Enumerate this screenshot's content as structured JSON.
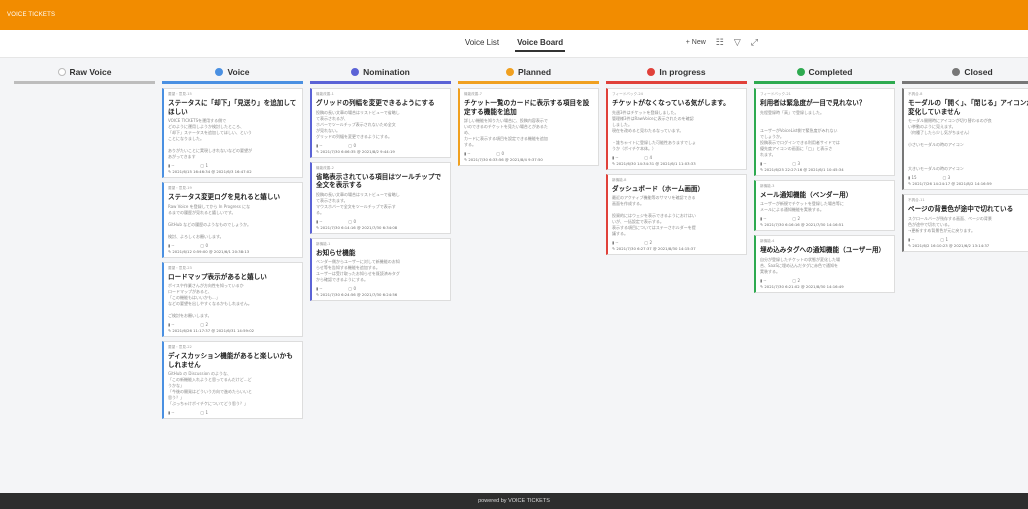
{
  "app_title": "VOICE TICKETS",
  "tabs": [
    {
      "label": "Voice List"
    },
    {
      "label": "Voice Board"
    }
  ],
  "toolbar": {
    "new_label": "+ New"
  },
  "footer": "powered by VOICE TICKETS",
  "columns": [
    {
      "title": "Raw Voice",
      "color": "#bdbdbd",
      "icon_color": "#ffffff",
      "cards": []
    },
    {
      "title": "Voice",
      "color": "#4a90e2",
      "icon_color": "#4a90e2",
      "cards": [
        {
          "id": "要望・意見-15",
          "title": "ステータスに「却下」「見送り」を追加してほしい",
          "body": "VOICE TICKETSを運用する側で\nどのように運用しようか検討したところ、\n「却下」ステータスを追加してほしい、という\nことになりました。\n\nありがたいことに実現しきれないなどの要望が\nあがってきます",
          "votes": "--",
          "comments": "1",
          "dates": "2021/6/15 16:46:34  @ 2021/6/3 16:47:02"
        },
        {
          "id": "要望・意見-19",
          "title": "ステータス変更ログを見れると嬉しい",
          "body": "Raw Voice を登録してから In Progress にな\nるまでの履歴が見れると嬉しいです。\n\nGitHub などの履歴のようなものでしょうか。\n\n検討、よろしくお願いします。",
          "votes": "--",
          "comments": "0",
          "dates": "2021/6/12 0:59:00  @ 2021/6/1 20:38:13"
        },
        {
          "id": "要望・意見-23",
          "title": "ロードマップ表示があると嬉しい",
          "body": "ボイスや作業さんが方向性を知っているか\nロードマップがあると、\n「この機能もはいいかも...」\nなどの要望を出しやすくなるかもしれません。\n\nご検討をお願いします。",
          "votes": "--",
          "comments": "2",
          "dates": "2021/6/26 11:17:37  @ 2021/6/31 14:59:02"
        },
        {
          "id": "要望・意見-22",
          "title": "ディスカッション機能があると楽しいかもしれません",
          "body": "GitHub の Discussion のような、\n「この新機能入れようと思ってるんだけど...ど\nうかな」\n「今後の開発はどういう方向で進めたらいいと\n思う？」\n「ぶっちゃけボイチケについてどう思う？」",
          "votes": "--",
          "comments": "1",
          "dates": ""
        }
      ]
    },
    {
      "title": "Nomination",
      "color": "#5b63d6",
      "icon_color": "#5b63d6",
      "cards": [
        {
          "id": "機能改善-1",
          "title": "グリッドの列幅を変更できるようにする",
          "body": "投稿の長い文章の場合はリストビューで省略し\nて表示されるが、\nホバーでツールチップ表示されないため全文\nが見れない。\nグリッドの列幅を変更できるようにする。",
          "votes": "--",
          "comments": "0",
          "dates": "2021/7/30 6:06:35  @ 2021/8/2 9:44:19"
        },
        {
          "id": "機能改善-2",
          "title": "省略表示されている項目はツールチップで全文を表示する",
          "body": "投稿の長い文章の場合はリストビューで省略し\nて表示されます。\nマウスホバーで全文をツールチップで表示す\nる。",
          "votes": "--",
          "comments": "0",
          "dates": "2021/7/30 6:14:16  @ 2021/7/30 6:34:08"
        },
        {
          "id": "新機能-1",
          "title": "お知らせ機能",
          "body": "ベンダー側からユーザーに対して新機能のお知\nらせ等を告知する機能を追加する。\nユーザーは受け取ったお知らせを既読済みタグ\nから確認できるようにする。",
          "votes": "--",
          "comments": "0",
          "dates": "2021/7/30 6:24:56  @ 2021/7/30 6:24:56"
        }
      ]
    },
    {
      "title": "Planned",
      "color": "#f0a020",
      "icon_color": "#f0a020",
      "cards": [
        {
          "id": "機能改善-7",
          "title": "チケット一覧のカードに表示する項目を設定する機能を追加",
          "body": "詳しい機能を知りたい場合に、投稿内容表示で\nいのできるのチケットを見たい場合とがあるた\nめ、\nカードに表示する項目を設定できる機能を追加\nする。",
          "votes": "--",
          "comments": "0",
          "dates": "2021/7/30 6:33:56  @ 2021/8/4 9:37:50"
        }
      ]
    },
    {
      "title": "In progress",
      "color": "#e0413a",
      "icon_color": "#e0413a",
      "cards": [
        {
          "id": "フィードバック-24",
          "title": "チケットがなくなっている気がします。",
          "body": "先週3件はチケットを登録しました。\n管理様3件はRawVoiceに表示されたのを確認\nしました。\n現在を改めると見わたるなっています。\n\n・誰ちゃイトに登録した可能性ありますでしょ\nうか（ボイチケ本体。）",
          "votes": "--",
          "comments": "4",
          "dates": "2021/6/30 14:34:31  @ 2021/6/1 11:03:33"
        },
        {
          "id": "新機能-8",
          "title": "ダッシュボード（ホーム画面）",
          "body": "最近のアクティブ機能等のサマリを確認できる\n画面を作成する。\n\n投資的にはウェジを表示できるようにおけはい\nいが、一括設定で表示する。\n表示する項目についてはステーさホルダーを提\n議する。",
          "votes": "--",
          "comments": "2",
          "dates": "2021/7/30 6:27:37  @ 2021/8/30 14:15:37"
        }
      ]
    },
    {
      "title": "Completed",
      "color": "#2eaa50",
      "icon_color": "#2eaa50",
      "cards": [
        {
          "id": "フィードバック-21",
          "title": "利用者は緊急度が一目で見れない？",
          "body": "先程登録時「高」で登録しました。\n\n\nユーザーがVoiceList側で緊急度がみれない\nでしょうか。\n投稿表示でログインできる利用者サイドでは\n優先度アイコンの画面に「◯」と表示さ\nれます。",
          "votes": "--",
          "comments": "3",
          "dates": "2021/6/25 22:27:16  @ 2021/6/1 10:45:34"
        },
        {
          "id": "新機能-3",
          "title": "メール通知機能（ベンダー用）",
          "body": "ユーザーが新規でチケットを登録した場合等に\nメールによる通知機能を実装する。",
          "votes": "--",
          "comments": "2",
          "dates": "2021/7/30 6:16:16  @ 2021/7/30 14:16:51"
        },
        {
          "id": "新機能-4",
          "title": "埋め込みタグへの通知機能（ユーザー用）",
          "body": "自分が登録したチケットの状態が変化した場\n合、SaaSに埋め込んだタグに赤色で通知を\n実装する。",
          "votes": "--",
          "comments": "2",
          "dates": "2021/7/30 6:21:02  @ 2021/8/30 14:16:49"
        }
      ]
    },
    {
      "title": "Closed",
      "color": "#777777",
      "icon_color": "#777777",
      "cards": [
        {
          "id": "不具合-8",
          "title": "モーダルの「開く」、「閉じる」アイコンが変化していません",
          "body": "モーダル開閉時にアイコンが切り替わるのが良\nい挙動のように見えます。\n（何種了したら少し気がちません）\n\n小さいモーダルの時のアイコン\n\n\n\n大きいモーダルの時のアイコン",
          "votes": "15",
          "comments": "3",
          "dates": "2021/7/26 14:24:17  @ 2021/8/2 14:16:59"
        },
        {
          "id": "不具合-11",
          "title": "ページの背景色が途中で切れている",
          "body": "スクロールバーが残存する画面、ページの背景\n色が途中で切れている。\n→更新すすめ背景色が元に戻ります。",
          "votes": "--",
          "comments": "1",
          "dates": "2021/6/2 16:10:23  @ 2021/6/2 13:14:37"
        }
      ]
    }
  ]
}
